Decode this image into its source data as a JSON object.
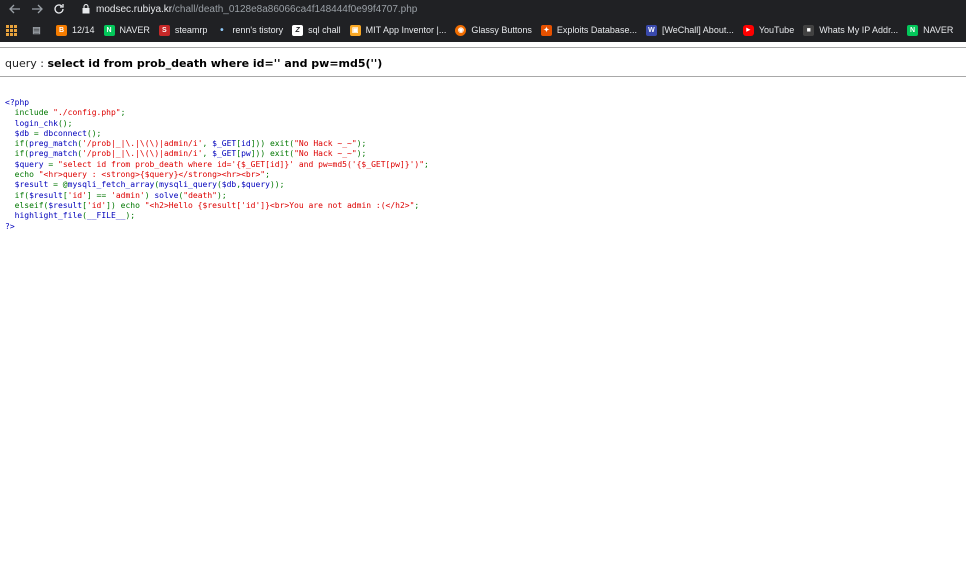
{
  "browser": {
    "url_host": "modsec.rubiya.kr",
    "url_path": "/chall/death_0128e8a86066ca4f148444f0e99f4707.php",
    "bookmarks": [
      {
        "label": "",
        "icon": "apps-icon",
        "color": "#e8a33d"
      },
      {
        "label": "",
        "icon": "bookmark-folder-icon",
        "color": "#9aa0a6"
      },
      {
        "label": "12/14",
        "icon": "blogger-icon",
        "color": "#f57c00"
      },
      {
        "label": "NAVER",
        "icon": "naver-icon",
        "color": "#03c75a"
      },
      {
        "label": "steamrp",
        "icon": "steam-icon",
        "color": "#c62828"
      },
      {
        "label": "renn's tistory",
        "icon": "tistory-icon",
        "color": "#90caf9"
      },
      {
        "label": "sql chall",
        "icon": "z-icon",
        "color": "#202124"
      },
      {
        "label": "MIT App Inventor |...",
        "icon": "mit-app-inventor-icon",
        "color": "#f9a825"
      },
      {
        "label": "Glassy Buttons",
        "icon": "glassy-buttons-icon",
        "color": "#ef6c00"
      },
      {
        "label": "Exploits Database...",
        "icon": "exploit-db-icon",
        "color": "#e65100"
      },
      {
        "label": "[WeChall] About...",
        "icon": "wechall-icon",
        "color": "#3949ab"
      },
      {
        "label": "YouTube",
        "icon": "youtube-icon",
        "color": "#ff0000"
      },
      {
        "label": "Whats My IP Addr...",
        "icon": "whatsmyip-icon",
        "color": "#424242"
      },
      {
        "label": "NAVER",
        "icon": "naver-icon",
        "color": "#03c75a"
      }
    ]
  },
  "page": {
    "query_label": "query : ",
    "query_value": "select id from prob_death where id='' and pw=md5('')"
  },
  "source_code": [
    {
      "segments": [
        {
          "t": "<?php",
          "c": "php"
        }
      ]
    },
    {
      "segments": [
        {
          "t": "  ",
          "c": "php"
        },
        {
          "t": "include ",
          "c": "kw"
        },
        {
          "t": "\"./config.php\"",
          "c": "str"
        },
        {
          "t": ";",
          "c": "kw"
        }
      ]
    },
    {
      "segments": [
        {
          "t": "  login_chk",
          "c": "php"
        },
        {
          "t": "();",
          "c": "kw"
        }
      ]
    },
    {
      "segments": [
        {
          "t": "  $db ",
          "c": "php"
        },
        {
          "t": "= ",
          "c": "kw"
        },
        {
          "t": "dbconnect",
          "c": "php"
        },
        {
          "t": "();",
          "c": "kw"
        }
      ]
    },
    {
      "segments": [
        {
          "t": "  ",
          "c": "php"
        },
        {
          "t": "if(",
          "c": "kw"
        },
        {
          "t": "preg_match",
          "c": "php"
        },
        {
          "t": "(",
          "c": "kw"
        },
        {
          "t": "'/prob|_|\\.|\\(\\)|admin/i'",
          "c": "str"
        },
        {
          "t": ", ",
          "c": "kw"
        },
        {
          "t": "$_GET",
          "c": "php"
        },
        {
          "t": "[",
          "c": "kw"
        },
        {
          "t": "id",
          "c": "php"
        },
        {
          "t": "])) exit(",
          "c": "kw"
        },
        {
          "t": "\"No Hack ~_~\"",
          "c": "str"
        },
        {
          "t": ");",
          "c": "kw"
        }
      ]
    },
    {
      "segments": [
        {
          "t": "  ",
          "c": "php"
        },
        {
          "t": "if(",
          "c": "kw"
        },
        {
          "t": "preg_match",
          "c": "php"
        },
        {
          "t": "(",
          "c": "kw"
        },
        {
          "t": "'/prob|_|\\.|\\(\\)|admin/i'",
          "c": "str"
        },
        {
          "t": ", ",
          "c": "kw"
        },
        {
          "t": "$_GET",
          "c": "php"
        },
        {
          "t": "[",
          "c": "kw"
        },
        {
          "t": "pw",
          "c": "php"
        },
        {
          "t": "])) exit(",
          "c": "kw"
        },
        {
          "t": "\"No Hack ~_~\"",
          "c": "str"
        },
        {
          "t": ");",
          "c": "kw"
        }
      ]
    },
    {
      "segments": [
        {
          "t": "  $query ",
          "c": "php"
        },
        {
          "t": "= ",
          "c": "kw"
        },
        {
          "t": "\"select id from prob_death where id='{$_GET[id]}' and pw=md5('{$_GET[pw]}')\"",
          "c": "str"
        },
        {
          "t": ";",
          "c": "kw"
        }
      ]
    },
    {
      "segments": [
        {
          "t": "  ",
          "c": "php"
        },
        {
          "t": "echo ",
          "c": "kw"
        },
        {
          "t": "\"<hr>query : <strong>{$query}</strong><hr><br>\"",
          "c": "str"
        },
        {
          "t": ";",
          "c": "kw"
        }
      ]
    },
    {
      "segments": [
        {
          "t": "  $result ",
          "c": "php"
        },
        {
          "t": "= @",
          "c": "kw"
        },
        {
          "t": "mysqli_fetch_array",
          "c": "php"
        },
        {
          "t": "(",
          "c": "kw"
        },
        {
          "t": "mysqli_query",
          "c": "php"
        },
        {
          "t": "(",
          "c": "kw"
        },
        {
          "t": "$db",
          "c": "php"
        },
        {
          "t": ",",
          "c": "kw"
        },
        {
          "t": "$query",
          "c": "php"
        },
        {
          "t": "));",
          "c": "kw"
        }
      ]
    },
    {
      "segments": [
        {
          "t": "  ",
          "c": "php"
        },
        {
          "t": "if(",
          "c": "kw"
        },
        {
          "t": "$result",
          "c": "php"
        },
        {
          "t": "[",
          "c": "kw"
        },
        {
          "t": "'id'",
          "c": "str"
        },
        {
          "t": "] == ",
          "c": "kw"
        },
        {
          "t": "'admin'",
          "c": "str"
        },
        {
          "t": ") ",
          "c": "kw"
        },
        {
          "t": "solve",
          "c": "php"
        },
        {
          "t": "(",
          "c": "kw"
        },
        {
          "t": "\"death\"",
          "c": "str"
        },
        {
          "t": ");",
          "c": "kw"
        }
      ]
    },
    {
      "segments": [
        {
          "t": "  ",
          "c": "php"
        },
        {
          "t": "elseif(",
          "c": "kw"
        },
        {
          "t": "$result",
          "c": "php"
        },
        {
          "t": "[",
          "c": "kw"
        },
        {
          "t": "'id'",
          "c": "str"
        },
        {
          "t": "]) echo ",
          "c": "kw"
        },
        {
          "t": "\"<h2>Hello {$result['id']}<br>You are not admin :(</h2>\"",
          "c": "str"
        },
        {
          "t": ";",
          "c": "kw"
        }
      ]
    },
    {
      "segments": [
        {
          "t": "  ",
          "c": "php"
        },
        {
          "t": "highlight_file",
          "c": "php"
        },
        {
          "t": "(",
          "c": "kw"
        },
        {
          "t": "__FILE__",
          "c": "php"
        },
        {
          "t": ");",
          "c": "kw"
        }
      ]
    },
    {
      "segments": [
        {
          "t": "?>",
          "c": "php"
        }
      ]
    }
  ],
  "colors": {
    "chrome_bg": "#202124",
    "php_default": "#0000bb",
    "php_string": "#dd0000",
    "php_keyword": "#007700"
  }
}
